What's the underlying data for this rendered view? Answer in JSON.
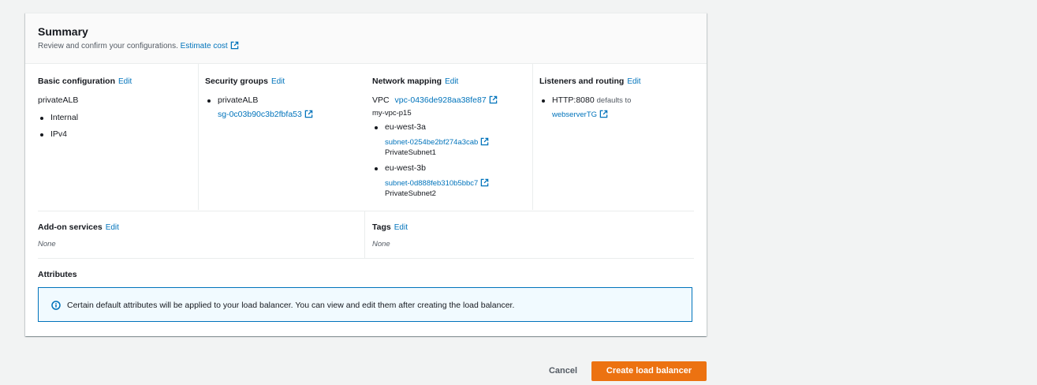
{
  "summary": {
    "title": "Summary",
    "description": "Review and confirm your configurations.",
    "estimate_cost_link": "Estimate cost"
  },
  "edit_label": "Edit",
  "basic_configuration": {
    "title": "Basic configuration",
    "name": "privateALB",
    "items": [
      "Internal",
      "IPv4"
    ]
  },
  "security_groups": {
    "title": "Security groups",
    "group_name": "privateALB",
    "group_id": "sg-0c03b90c3b2fbfa53"
  },
  "network_mapping": {
    "title": "Network mapping",
    "vpc_label": "VPC",
    "vpc_id": "vpc-0436de928aa38fe87",
    "vpc_name": "my-vpc-p15",
    "zones": [
      {
        "zone": "eu-west-3a",
        "subnet_id": "subnet-0254be2bf274a3cab",
        "subnet_name": "PrivateSubnet1"
      },
      {
        "zone": "eu-west-3b",
        "subnet_id": "subnet-0d888feb310b5bbc7",
        "subnet_name": "PrivateSubnet2"
      }
    ]
  },
  "listeners": {
    "title": "Listeners and routing",
    "listener": "HTTP:8080",
    "defaults_to": "defaults to",
    "target_group": "webserverTG"
  },
  "addon_services": {
    "title": "Add-on services",
    "value": "None"
  },
  "tags": {
    "title": "Tags",
    "value": "None"
  },
  "attributes": {
    "title": "Attributes",
    "info": "Certain default attributes will be applied to your load balancer. You can view and edit them after creating the load balancer."
  },
  "actions": {
    "cancel": "Cancel",
    "create": "Create load balancer"
  },
  "colors": {
    "link": "#0073bb",
    "primary_button": "#ec7211",
    "info_border": "#0073bb",
    "info_bg": "#f1faff"
  }
}
